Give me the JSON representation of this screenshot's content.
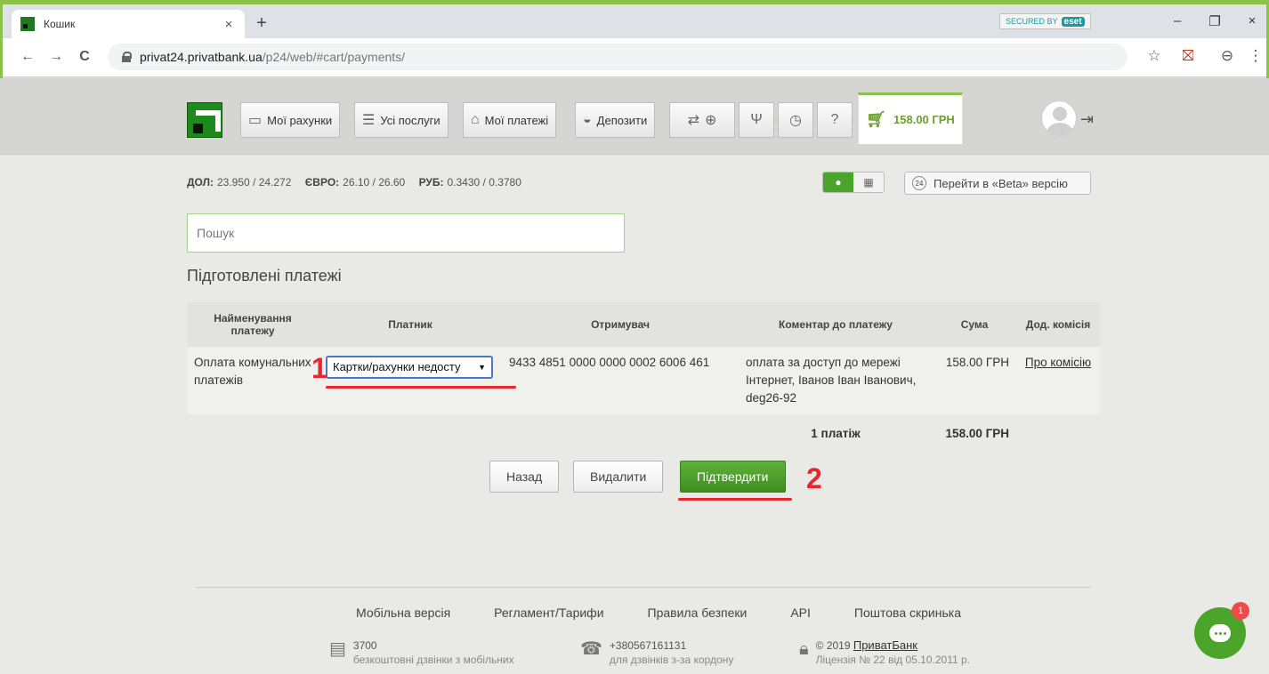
{
  "browser": {
    "tab_title": "Кошик",
    "tab_close": "×",
    "new_tab": "+",
    "eset_label": "SECURED BY",
    "eset_brand": "eset",
    "minimize": "–",
    "restore": "❐",
    "close": "×",
    "back": "←",
    "forward": "→",
    "reload": "C",
    "url_host": "privat24.privatbank.ua",
    "url_path": "/p24/web/#cart/payments/",
    "star": "☆",
    "ext": "⛝",
    "profile": "⊖",
    "menu": "⋮"
  },
  "nav": {
    "items": [
      {
        "label": "Мої рахунки",
        "icon": "card-icon"
      },
      {
        "label": "Усі послуги",
        "icon": "list-icon"
      },
      {
        "label": "Мої платежі",
        "icon": "house-icon"
      },
      {
        "label": "Депозити",
        "icon": "piggy-icon"
      }
    ],
    "cart_amount": "158.00 ГРН"
  },
  "rates": {
    "usd_label": "ДОЛ:",
    "usd_value": "23.950 / 24.272",
    "eur_label": "ЄВРО:",
    "eur_value": "26.10 / 26.60",
    "rub_label": "РУБ:",
    "rub_value": "0.3430 / 0.3780"
  },
  "beta": {
    "badge": "24",
    "label": "Перейти в «Beta» версію"
  },
  "search": {
    "placeholder": "Пошук"
  },
  "section_title": "Підготовлені платежі",
  "table": {
    "headers": [
      "Найменування платежу",
      "Платник",
      "Отримувач",
      "Коментар до платежу",
      "Сума",
      "Дод. комісія"
    ],
    "row": {
      "name": "Оплата комунальних платежів",
      "payer": "Картки/рахунки недосту",
      "recipient": "9433 4851 0000 0000 0002 6006 461",
      "comment": "оплата за доступ до мережі Інтернет, Іванов Іван Іванович, deg26-92",
      "amount": "158.00 ГРН",
      "commission": "Про комісію"
    },
    "total_count": "1 платіж",
    "total_amount": "158.00 ГРН"
  },
  "buttons": {
    "back": "Назад",
    "delete": "Видалити",
    "confirm": "Підтвердити"
  },
  "annotations": {
    "one": "1",
    "two": "2"
  },
  "footer": {
    "links": [
      "Мобільна версія",
      "Регламент/Тарифи",
      "Правила безпеки",
      "API",
      "Поштова скринька"
    ],
    "phone1": "3700",
    "phone1_sub": "безкоштовні дзвінки з мобільних",
    "phone2": "+380567161131",
    "phone2_sub": "для дзвінків з-за кордону",
    "copyright_prefix": "© 2019 ",
    "copyright_link": "ПриватБанк",
    "license": "Ліцензія № 22 від 05.10.2011 р."
  },
  "chat": {
    "badge": "1"
  },
  "colors": {
    "brand_green": "#4aa52a",
    "annotation_red": "#e8262b"
  }
}
